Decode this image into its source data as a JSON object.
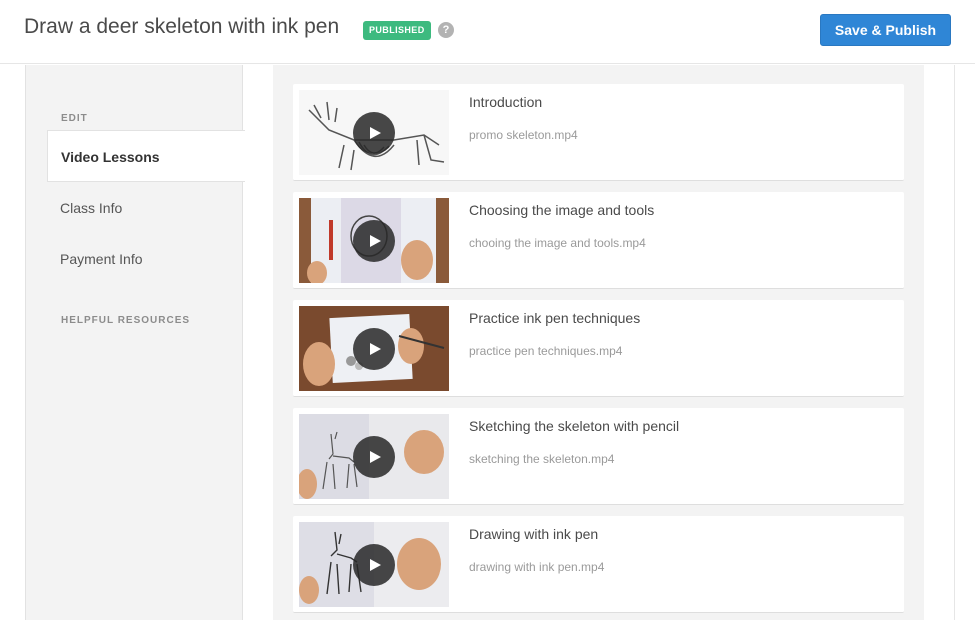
{
  "header": {
    "title": "Draw a deer skeleton with ink pen",
    "status_badge": "PUBLISHED",
    "help_icon": "question-circle-icon",
    "help_glyph": "?",
    "save_label": "Save & Publish"
  },
  "colors": {
    "accent": "#2f86d6",
    "badge": "#3dba7f",
    "panel_bg": "#f3f3f3"
  },
  "sidebar": {
    "edit_label": "EDIT",
    "items": [
      {
        "label": "Video Lessons",
        "active": true
      },
      {
        "label": "Class Info",
        "active": false
      },
      {
        "label": "Payment Info",
        "active": false
      }
    ],
    "resources_label": "HELPFUL RESOURCES"
  },
  "lessons": [
    {
      "title": "Introduction",
      "file": "promo skeleton.mp4"
    },
    {
      "title": "Choosing the image and tools",
      "file": "chooing the image and tools.mp4"
    },
    {
      "title": "Practice ink pen techniques",
      "file": "practice pen techniques.mp4"
    },
    {
      "title": "Sketching the skeleton with pencil",
      "file": "sketching the skeleton.mp4"
    },
    {
      "title": "Drawing with ink pen",
      "file": "drawing with ink pen.mp4"
    }
  ]
}
